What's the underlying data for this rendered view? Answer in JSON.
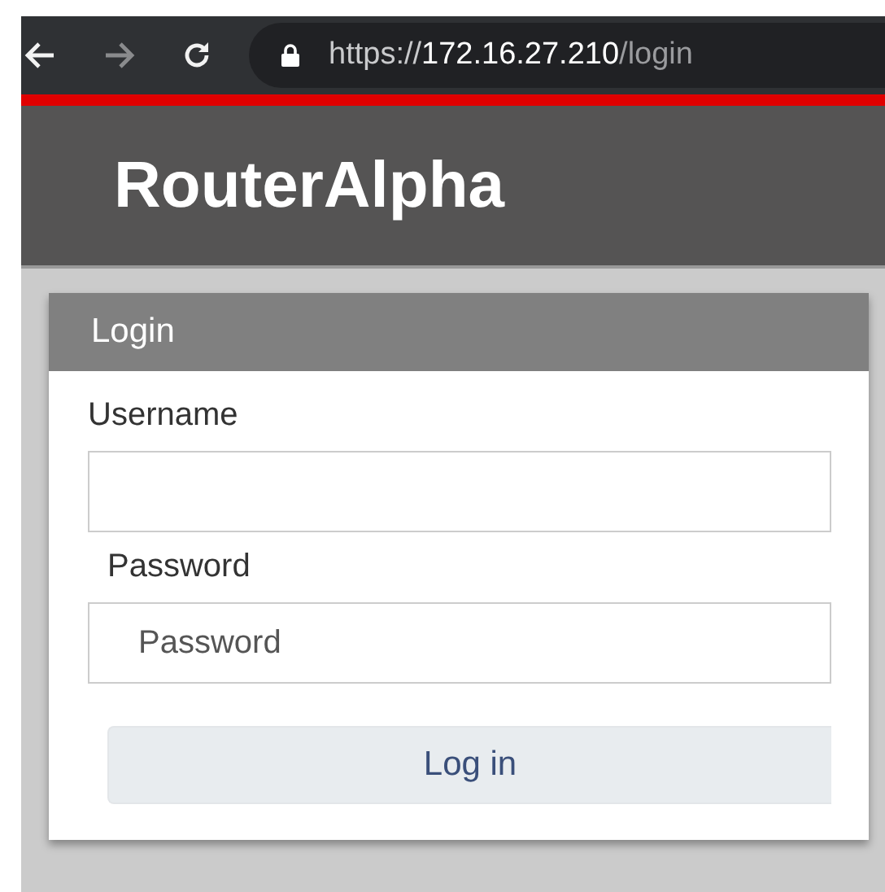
{
  "browser": {
    "url": {
      "scheme": "https://",
      "host": "172.16.27.210",
      "path": "/login"
    },
    "back_disabled": false,
    "forward_disabled": true
  },
  "header": {
    "title": "RouterAlpha"
  },
  "login": {
    "title": "Login",
    "fields": [
      {
        "label": "Username"
      },
      {
        "label": "Password",
        "placeholder": "Password"
      }
    ],
    "button": "Log in"
  }
}
